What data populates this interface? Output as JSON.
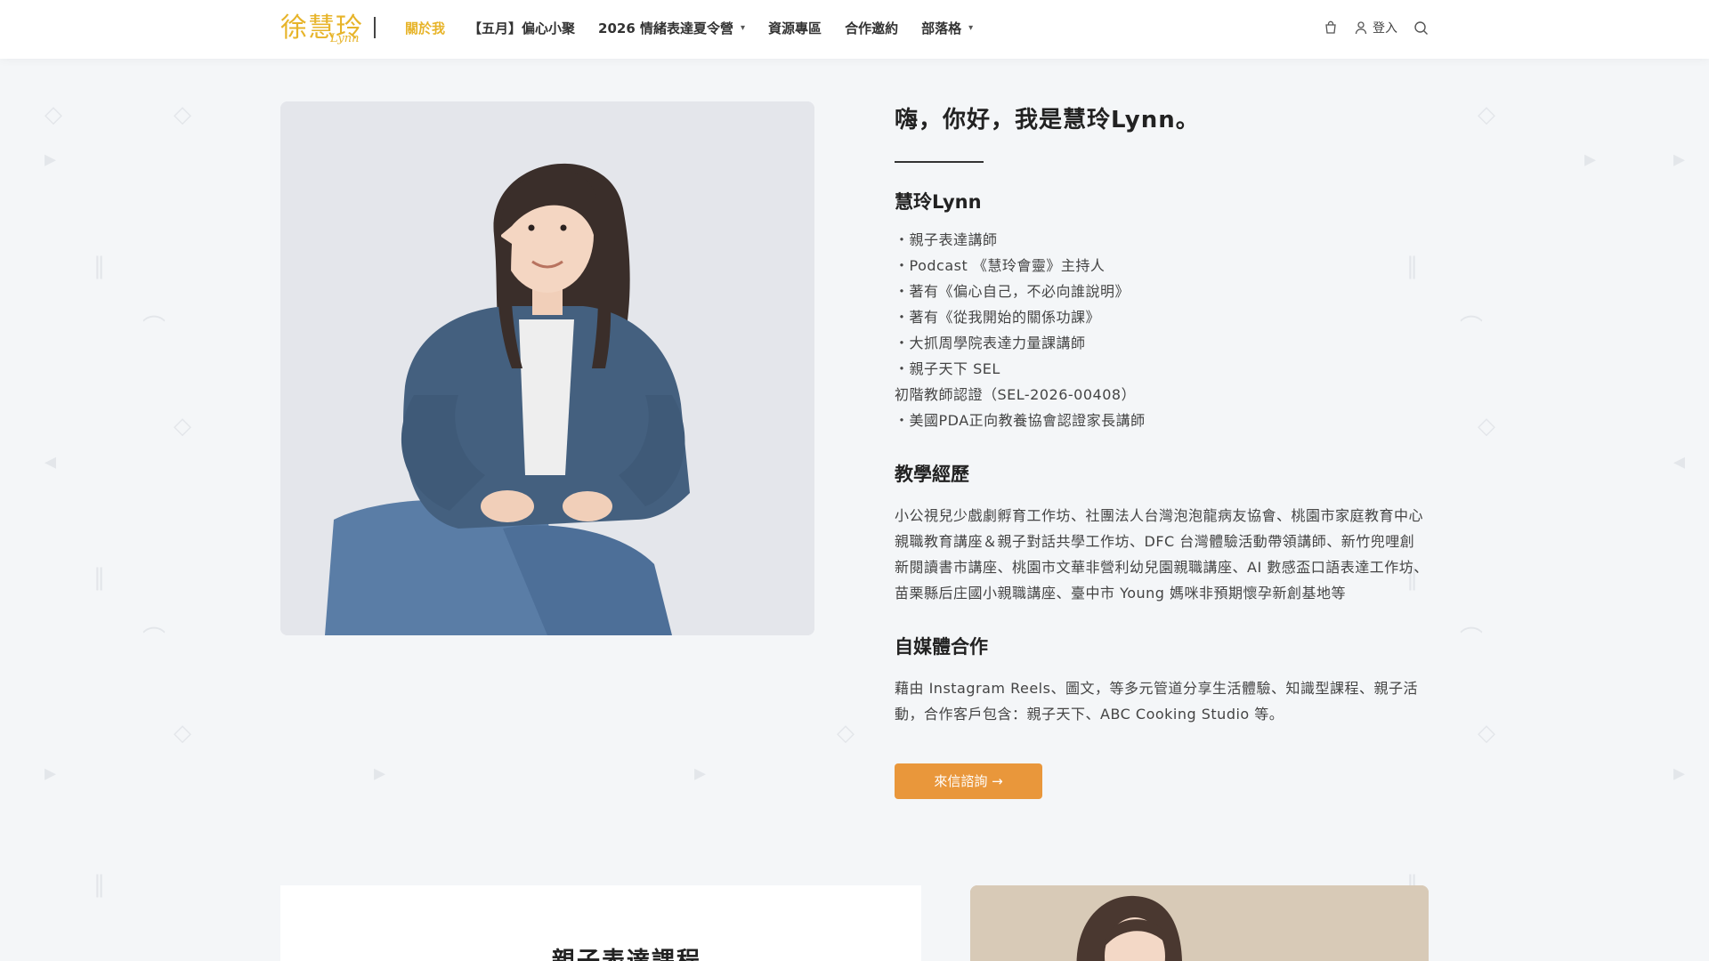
{
  "header": {
    "logo_cn": "徐慧玲",
    "logo_en": "Lynn",
    "nav": [
      {
        "label": "關於我",
        "active": true,
        "has_dropdown": false
      },
      {
        "label": "【五月】偏心小聚",
        "active": false,
        "has_dropdown": false
      },
      {
        "label": "2026 情緒表達夏令營",
        "active": false,
        "has_dropdown": true
      },
      {
        "label": "資源專區",
        "active": false,
        "has_dropdown": false
      },
      {
        "label": "合作邀約",
        "active": false,
        "has_dropdown": false
      },
      {
        "label": "部落格",
        "active": false,
        "has_dropdown": true
      }
    ],
    "login_label": "登入",
    "icons": [
      "cart-icon",
      "user-icon",
      "search-icon"
    ]
  },
  "about": {
    "greeting": "嗨，你好，我是慧玲Lynn。",
    "name_title": "慧玲Lynn",
    "credentials": [
      "・親子表達講師",
      "・Podcast 《慧玲會靈》主持人",
      "・著有《偏心自己，不必向誰說明》",
      "・著有《從我開始的關係功課》",
      "・大抓周學院表達力量課講師",
      "・親子天下 SEL",
      "初階教師認證（SEL-2026-00408）",
      "・美國PDA正向教養協會認證家長講師"
    ],
    "teaching_title": "教學經歷",
    "teaching_text": "小公視兒少戲劇孵育工作坊、社團法人台灣泡泡龍病友協會、桃園市家庭教育中心親職教育講座＆親子對話共學工作坊、DFC 台灣體驗活動帶領講師、新竹兜哩創新閱讀書市講座、桃園市文華非營利幼兒園親職講座、AI 數感盃口語表達工作坊、苗栗縣后庄國小親職講座、臺中市 Young 媽咪非預期懷孕新創基地等",
    "media_title": "自媒體合作",
    "media_text": "藉由 Instagram Reels、圖文，等多元管道分享生活體驗、知識型課程、親子活動，合作客戶包含：親子天下、ABC Cooking Studio 等。",
    "cta_label": "來信諮詢 →"
  },
  "courses": {
    "title": "親子表達課程"
  },
  "colors": {
    "accent_gold": "#e7b42a",
    "cta_orange": "#e9973b",
    "background": "#f4f6f8"
  }
}
